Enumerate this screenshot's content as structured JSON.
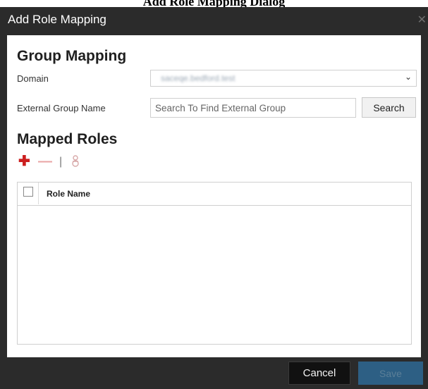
{
  "caption": "Add Role Mapping Dialog",
  "dialog": {
    "title": "Add Role Mapping",
    "close_icon": "close-icon"
  },
  "group_mapping": {
    "heading": "Group Mapping",
    "domain_label": "Domain",
    "domain_value": "saceqe.bedford.test",
    "external_group_label": "External Group Name",
    "external_group_placeholder": "Search To Find External Group",
    "external_group_value": "",
    "search_label": "Search"
  },
  "mapped_roles": {
    "heading": "Mapped Roles",
    "toolbar": {
      "add_icon": "plus-icon",
      "remove_icon": "minus-icon",
      "divider": "|",
      "settings_icon": "role-settings-icon"
    },
    "columns": [
      "Role Name"
    ],
    "rows": []
  },
  "footer": {
    "cancel_label": "Cancel",
    "save_label": "Save"
  },
  "colors": {
    "frame": "#2b2b2b",
    "add_icon": "#cc1f1f",
    "remove_icon": "#e8a3a3",
    "save_button": "#2d5f84"
  }
}
